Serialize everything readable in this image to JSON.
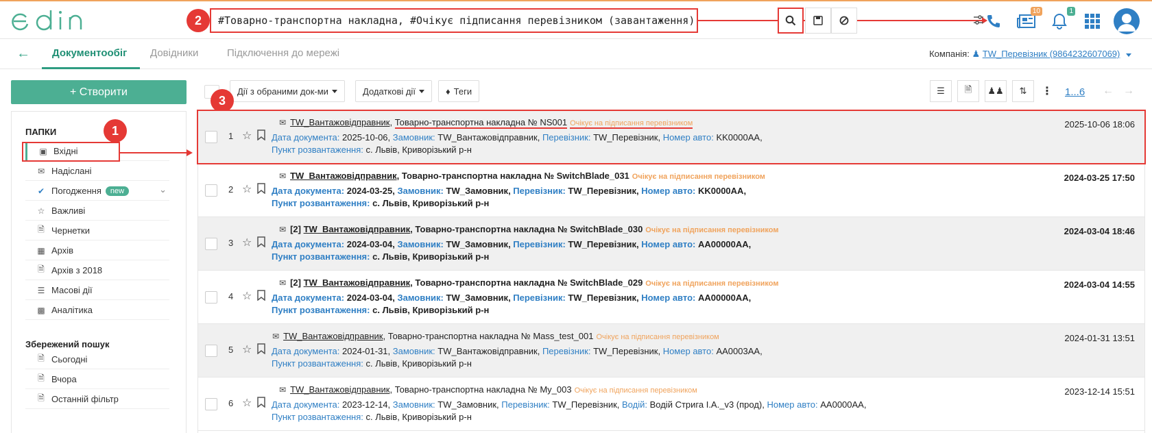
{
  "brand": {
    "logo_text": "edin",
    "color": "#4caf93"
  },
  "search": {
    "query": "#Товарно-транспортна накладна, #Очікує підписання перевізником (завантаження),",
    "filter_icon": "sliders-icon",
    "buttons": [
      "search-icon",
      "save-icon",
      "clear-icon"
    ]
  },
  "top_icons": {
    "news_badge": "10",
    "notifications_badge": "1"
  },
  "nav": {
    "tabs": [
      "Документообіг",
      "Довідники",
      "Підключення до мережі"
    ],
    "company_label": "Компанія:",
    "company_value": "TW_Перевізник (9864232607069)"
  },
  "create_button": "+ Створити",
  "sidebar": {
    "folders_title": "ПАПКИ",
    "folders": [
      {
        "label": "Вхідні",
        "icon": "inbox-icon"
      },
      {
        "label": "Надіслані",
        "icon": "envelope-icon"
      },
      {
        "label": "Погодження",
        "icon": "check-icon",
        "badge": "new"
      },
      {
        "label": "Важливі",
        "icon": "star-icon"
      },
      {
        "label": "Чернетки",
        "icon": "file-icon"
      },
      {
        "label": "Архів",
        "icon": "archive-icon"
      },
      {
        "label": "Архів з 2018",
        "icon": "file-archive-icon"
      },
      {
        "label": "Масові дії",
        "icon": "list-icon"
      },
      {
        "label": "Аналітика",
        "icon": "chart-icon"
      }
    ],
    "saved_title": "Збережений пошук",
    "saved": [
      {
        "label": "Сьогодні"
      },
      {
        "label": "Вчора"
      },
      {
        "label": "Останній фільтр"
      }
    ]
  },
  "toolbar": {
    "selected_actions": "Дії з обраними док-ми",
    "extra_actions": "Додаткові дії",
    "tags": "Теги",
    "pager": "1...6"
  },
  "markers": [
    "1",
    "2",
    "3"
  ],
  "labels": {
    "doc_date": "Дата документа:",
    "customer": "Замовник:",
    "carrier": "Перевізник:",
    "car_number": "Номер авто:",
    "driver": "Водій:",
    "unload_point": "Пункт розвантаження:"
  },
  "documents": [
    {
      "num": "1",
      "prefix": "",
      "sender": "TW_Вантажовідправник",
      "title": "Товарно-транспортна накладна № NS001",
      "status": "Очікує на підписання перевізником",
      "doc_date": "2025-10-06",
      "customer": "TW_Вантажовідправник",
      "carrier": "TW_Перевізник",
      "driver": "",
      "car_number": "KK0000AA",
      "unload_point": "с. Львів, Криворізький р-н",
      "datetime": "2025-10-06 18:06",
      "bold": false
    },
    {
      "num": "2",
      "prefix": "",
      "sender": "TW_Вантажовідправник",
      "title": "Товарно-транспортна накладна № SwitchBlade_031",
      "status": "Очікує на підписання перевізником",
      "doc_date": "2024-03-25",
      "customer": "TW_Замовник",
      "carrier": "TW_Перевізник",
      "driver": "",
      "car_number": "KK0000AA",
      "unload_point": "с. Львів, Криворізький р-н",
      "datetime": "2024-03-25 17:50",
      "bold": true
    },
    {
      "num": "3",
      "prefix": "[2]",
      "sender": "TW_Вантажовідправник",
      "title": "Товарно-транспортна накладна № SwitchBlade_030",
      "status": "Очікує на підписання перевізником",
      "doc_date": "2024-03-04",
      "customer": "TW_Замовник",
      "carrier": "TW_Перевізник",
      "driver": "",
      "car_number": "AA00000AA",
      "unload_point": "с. Львів, Криворізький р-н",
      "datetime": "2024-03-04 18:46",
      "bold": true
    },
    {
      "num": "4",
      "prefix": "[2]",
      "sender": "TW_Вантажовідправник",
      "title": "Товарно-транспортна накладна № SwitchBlade_029",
      "status": "Очікує на підписання перевізником",
      "doc_date": "2024-03-04",
      "customer": "TW_Замовник",
      "carrier": "TW_Перевізник",
      "driver": "",
      "car_number": "AA00000AA",
      "unload_point": "с. Львів, Криворізький р-н",
      "datetime": "2024-03-04 14:55",
      "bold": true
    },
    {
      "num": "5",
      "prefix": "",
      "sender": "TW_Вантажовідправник",
      "title": "Товарно-транспортна накладна № Mass_test_001",
      "status": "Очікує на підписання перевізником",
      "doc_date": "2024-01-31",
      "customer": "TW_Вантажовідправник",
      "carrier": "TW_Перевізник",
      "driver": "",
      "car_number": "AA0003AA",
      "unload_point": "с. Львів, Криворізький р-н",
      "datetime": "2024-01-31 13:51",
      "bold": false
    },
    {
      "num": "6",
      "prefix": "",
      "sender": "TW_Вантажовідправник",
      "title": "Товарно-транспортна накладна № My_003",
      "status": "Очікує на підписання перевізником",
      "doc_date": "2023-12-14",
      "customer": "TW_Замовник",
      "carrier": "TW_Перевізник",
      "driver": "Водій Стрига І.А._v3 (прод)",
      "car_number": "AA0000AA",
      "unload_point": "с. Львів, Криворізький р-н",
      "datetime": "2023-12-14 15:51",
      "bold": false
    }
  ]
}
